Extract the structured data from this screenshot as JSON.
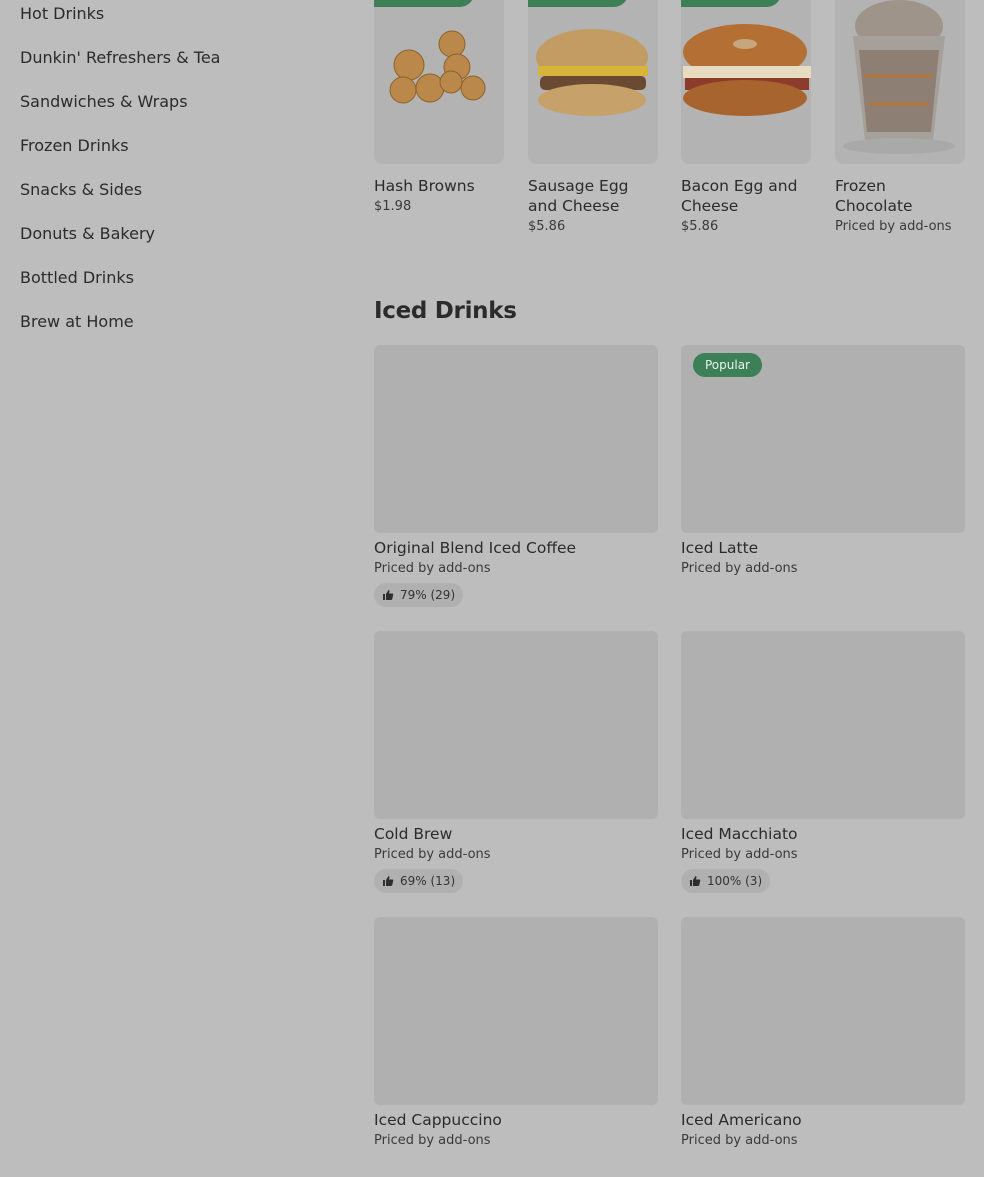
{
  "sidebar": {
    "items": [
      {
        "label": "Hot Drinks"
      },
      {
        "label": "Dunkin' Refreshers & Tea"
      },
      {
        "label": "Sandwiches & Wraps"
      },
      {
        "label": "Frozen Drinks"
      },
      {
        "label": "Snacks & Sides"
      },
      {
        "label": "Donuts & Bakery"
      },
      {
        "label": "Bottled Drinks"
      },
      {
        "label": "Brew at Home"
      }
    ]
  },
  "top_row": [
    {
      "name": "Hash Browns",
      "price": "$1.98",
      "image": "hash-browns"
    },
    {
      "name": "Sausage Egg and Cheese",
      "price": "$5.86",
      "image": "sausage-egg-cheese"
    },
    {
      "name": "Bacon Egg and Cheese",
      "price": "$5.86",
      "image": "bacon-egg-cheese"
    },
    {
      "name": "Frozen Chocolate",
      "price": "Priced by add-ons",
      "image": "frozen-chocolate"
    }
  ],
  "iced_drinks": {
    "title": "Iced Drinks",
    "items": [
      {
        "name": "Original Blend Iced Coffee",
        "price": "Priced by add-ons",
        "rating": "79% (29)"
      },
      {
        "name": "Iced Latte",
        "price": "Priced by add-ons",
        "badge": "Popular"
      },
      {
        "name": "Cold Brew",
        "price": "Priced by add-ons",
        "rating": "69% (13)"
      },
      {
        "name": "Iced Macchiato",
        "price": "Priced by add-ons",
        "rating": "100% (3)"
      },
      {
        "name": "Iced Cappuccino",
        "price": "Priced by add-ons"
      },
      {
        "name": "Iced Americano",
        "price": "Priced by add-ons"
      }
    ]
  },
  "colors": {
    "background": "#bdbdbd",
    "badge_green": "#3d7f57",
    "placeholder": "#b0b0b0"
  },
  "icons": {
    "rating": "thumbs-up-icon"
  }
}
